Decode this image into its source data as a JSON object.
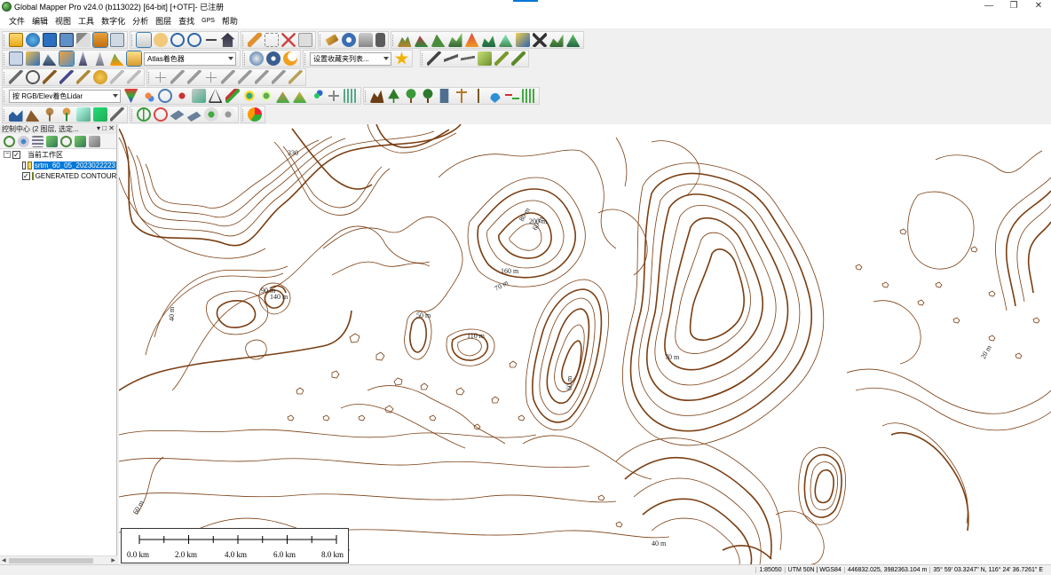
{
  "window": {
    "title": "Global Mapper Pro v24.0 (b113022) [64-bit] [+OTF]- 已注册",
    "controls": [
      "—",
      "❐",
      "✕"
    ]
  },
  "menu": [
    "文件",
    "编辑",
    "视图",
    "工具",
    "数字化",
    "分析",
    "图层",
    "查找",
    "GPS",
    "帮助"
  ],
  "toolbar": {
    "shader_combo": "Atlas着色器",
    "favorites_combo": "设置收藏夹列表...",
    "lidar_combo": "按 RGB/Elev着色Lidar"
  },
  "control_center": {
    "header": "控制中心 (2 图层, 选定...",
    "header_buttons": "▾ □ ✕",
    "workspace_label": "当前工作区",
    "layers": [
      {
        "name": "srtm_60_05_2023022223",
        "checked": false,
        "selected": true
      },
      {
        "name": "GENERATED CONTOUR",
        "checked": true,
        "selected": false
      }
    ]
  },
  "map": {
    "contour_labels": [
      {
        "text": "60 m"
      },
      {
        "text": "70 m"
      },
      {
        "text": "40 m"
      },
      {
        "text": "90 m"
      },
      {
        "text": "140 m"
      },
      {
        "text": "50 m"
      },
      {
        "text": "110 m"
      },
      {
        "text": "200 m"
      },
      {
        "text": "160 m"
      },
      {
        "text": "330"
      },
      {
        "text": "80 m"
      },
      {
        "text": "20 m"
      },
      {
        "text": "60 m"
      },
      {
        "text": "70 m"
      },
      {
        "text": "40 m"
      },
      {
        "text": "60 m"
      }
    ],
    "contour_color": "#7a3e12",
    "scale_labels": [
      "0.0 km",
      "2.0 km",
      "4.0 km",
      "6.0 km",
      "8.0 km"
    ]
  },
  "status": {
    "scale": "1:85050",
    "projection": "UTM 50N | WGS84",
    "coords": "446832.025, 3982363.104 m",
    "latlon": "35° 59' 03.3247\" N, 116° 24' 36.7261\" E"
  }
}
